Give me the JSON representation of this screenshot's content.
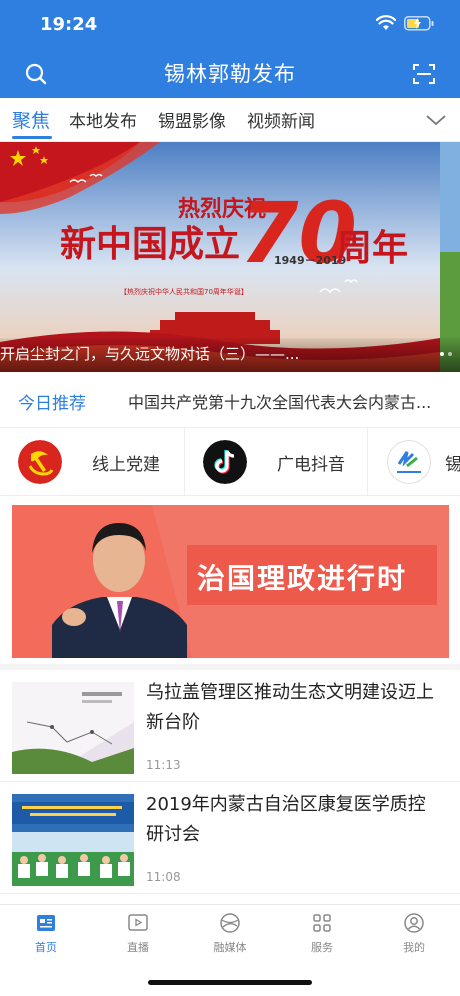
{
  "status": {
    "time": "19:24"
  },
  "header": {
    "title": "锡林郭勒发布",
    "search_icon": "search-icon",
    "scan_icon": "scan-icon"
  },
  "tabs": [
    {
      "label": "聚焦",
      "active": true
    },
    {
      "label": "本地发布"
    },
    {
      "label": "锡盟影像"
    },
    {
      "label": "视频新闻"
    }
  ],
  "banner": {
    "top_text": "热烈庆祝",
    "headline": "新中国成立",
    "number": "70",
    "years": "1949－2019",
    "suffix": "周年",
    "subline": "【热烈庆祝中华人民共和国70周年华诞】",
    "caption": "开启尘封之门，与久远文物对话（三）——..."
  },
  "recommend": {
    "label": "今日推荐",
    "text": "中国共产党第十九次全国代表大会内蒙古..."
  },
  "quick_links": [
    {
      "label": "线上党建",
      "icon": "party-emblem-icon"
    },
    {
      "label": "广电抖音",
      "icon": "tiktok-icon"
    },
    {
      "label": "锡",
      "icon": "station-logo-icon"
    }
  ],
  "promo": {
    "text": "治国理政进行时"
  },
  "news": [
    {
      "title": "乌拉盖管理区推动生态文明建设迈上新台阶",
      "time": "11:13"
    },
    {
      "title": "2019年内蒙古自治区康复医学质控研讨会",
      "time": "11:08"
    }
  ],
  "tabbar": [
    {
      "label": "首页",
      "icon": "home-news-icon",
      "active": true
    },
    {
      "label": "直播",
      "icon": "play-icon"
    },
    {
      "label": "融媒体",
      "icon": "media-icon"
    },
    {
      "label": "服务",
      "icon": "grid-icon"
    },
    {
      "label": "我的",
      "icon": "user-icon"
    }
  ],
  "colors": {
    "accent": "#2f7fe0",
    "banner_red": "#d8261f",
    "promo": "#f26b5b"
  }
}
